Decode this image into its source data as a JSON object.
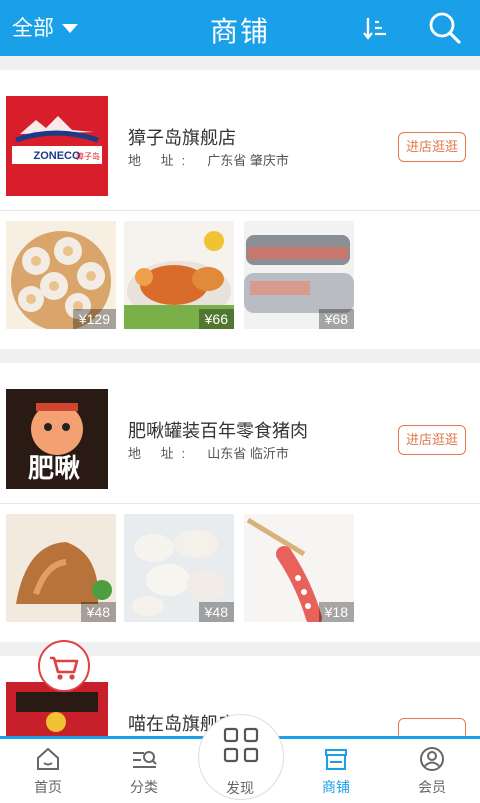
{
  "header": {
    "filter_label": "全部",
    "title": "商铺"
  },
  "stores": [
    {
      "name": "獐子岛旗舰店",
      "address_label": "地 址:",
      "address_value": "广东省 肇庆市",
      "visit_label": "进店逛逛",
      "logo_text": "ZONECO獐子岛",
      "products": [
        {
          "price": "¥129"
        },
        {
          "price": "¥66"
        },
        {
          "price": "¥68"
        }
      ]
    },
    {
      "name": "肥啾罐装百年零食猪肉",
      "address_label": "地 址:",
      "address_value": "山东省 临沂市",
      "visit_label": "进店逛逛",
      "logo_text": "肥啾",
      "products": [
        {
          "price": "¥48"
        },
        {
          "price": "¥48"
        },
        {
          "price": "¥18"
        }
      ]
    },
    {
      "name": "喵在岛旗舰店",
      "visit_label": ""
    }
  ],
  "nav": {
    "home": "首页",
    "category": "分类",
    "discover": "发现",
    "store": "商铺",
    "member": "会员"
  },
  "colors": {
    "brand": "#1aa0e8",
    "accent": "#e07a4a",
    "cart": "#e04040"
  },
  "icons": [
    "caret-down-icon",
    "sort-icon",
    "search-icon",
    "cart-icon",
    "home-icon",
    "category-icon",
    "grid-icon",
    "store-icon",
    "member-icon"
  ]
}
